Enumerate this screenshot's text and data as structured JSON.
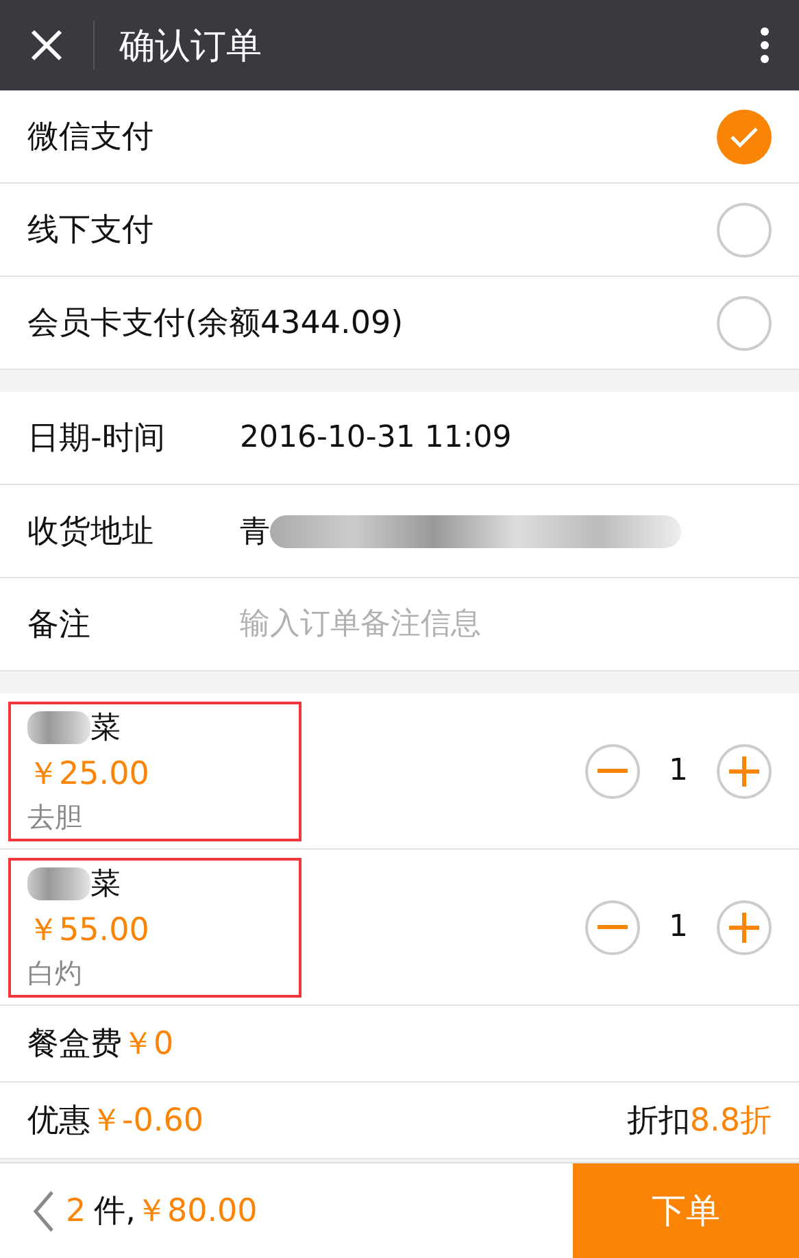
{
  "header": {
    "title": "确认订单"
  },
  "payment_methods": [
    {
      "label": "微信支付",
      "selected": true
    },
    {
      "label": "线下支付",
      "selected": false
    },
    {
      "label": "会员卡支付(余额4344.09)",
      "selected": false
    }
  ],
  "info_rows": [
    {
      "kind": "text",
      "label": "日期-时间",
      "value": "2016-10-31 11:09"
    },
    {
      "kind": "blurred",
      "label": "收货地址",
      "value": "青"
    },
    {
      "kind": "input",
      "label": "备注",
      "placeholder": "输入订单备注信息"
    }
  ],
  "items": [
    {
      "name": "菜",
      "price": "￥25.00",
      "note": "去胆",
      "quantity": "1"
    },
    {
      "name": "菜",
      "price": "￥55.00",
      "note": "白灼",
      "quantity": "1"
    }
  ],
  "box_fee": {
    "label": "餐盒费",
    "amount": "￥0"
  },
  "discount": {
    "label": "优惠",
    "amount": "￥-0.60",
    "rate_label": "折扣",
    "rate": "8.8折"
  },
  "footer": {
    "count": "2",
    "unit": "件,",
    "total": "￥80.00",
    "submit": "下单"
  }
}
